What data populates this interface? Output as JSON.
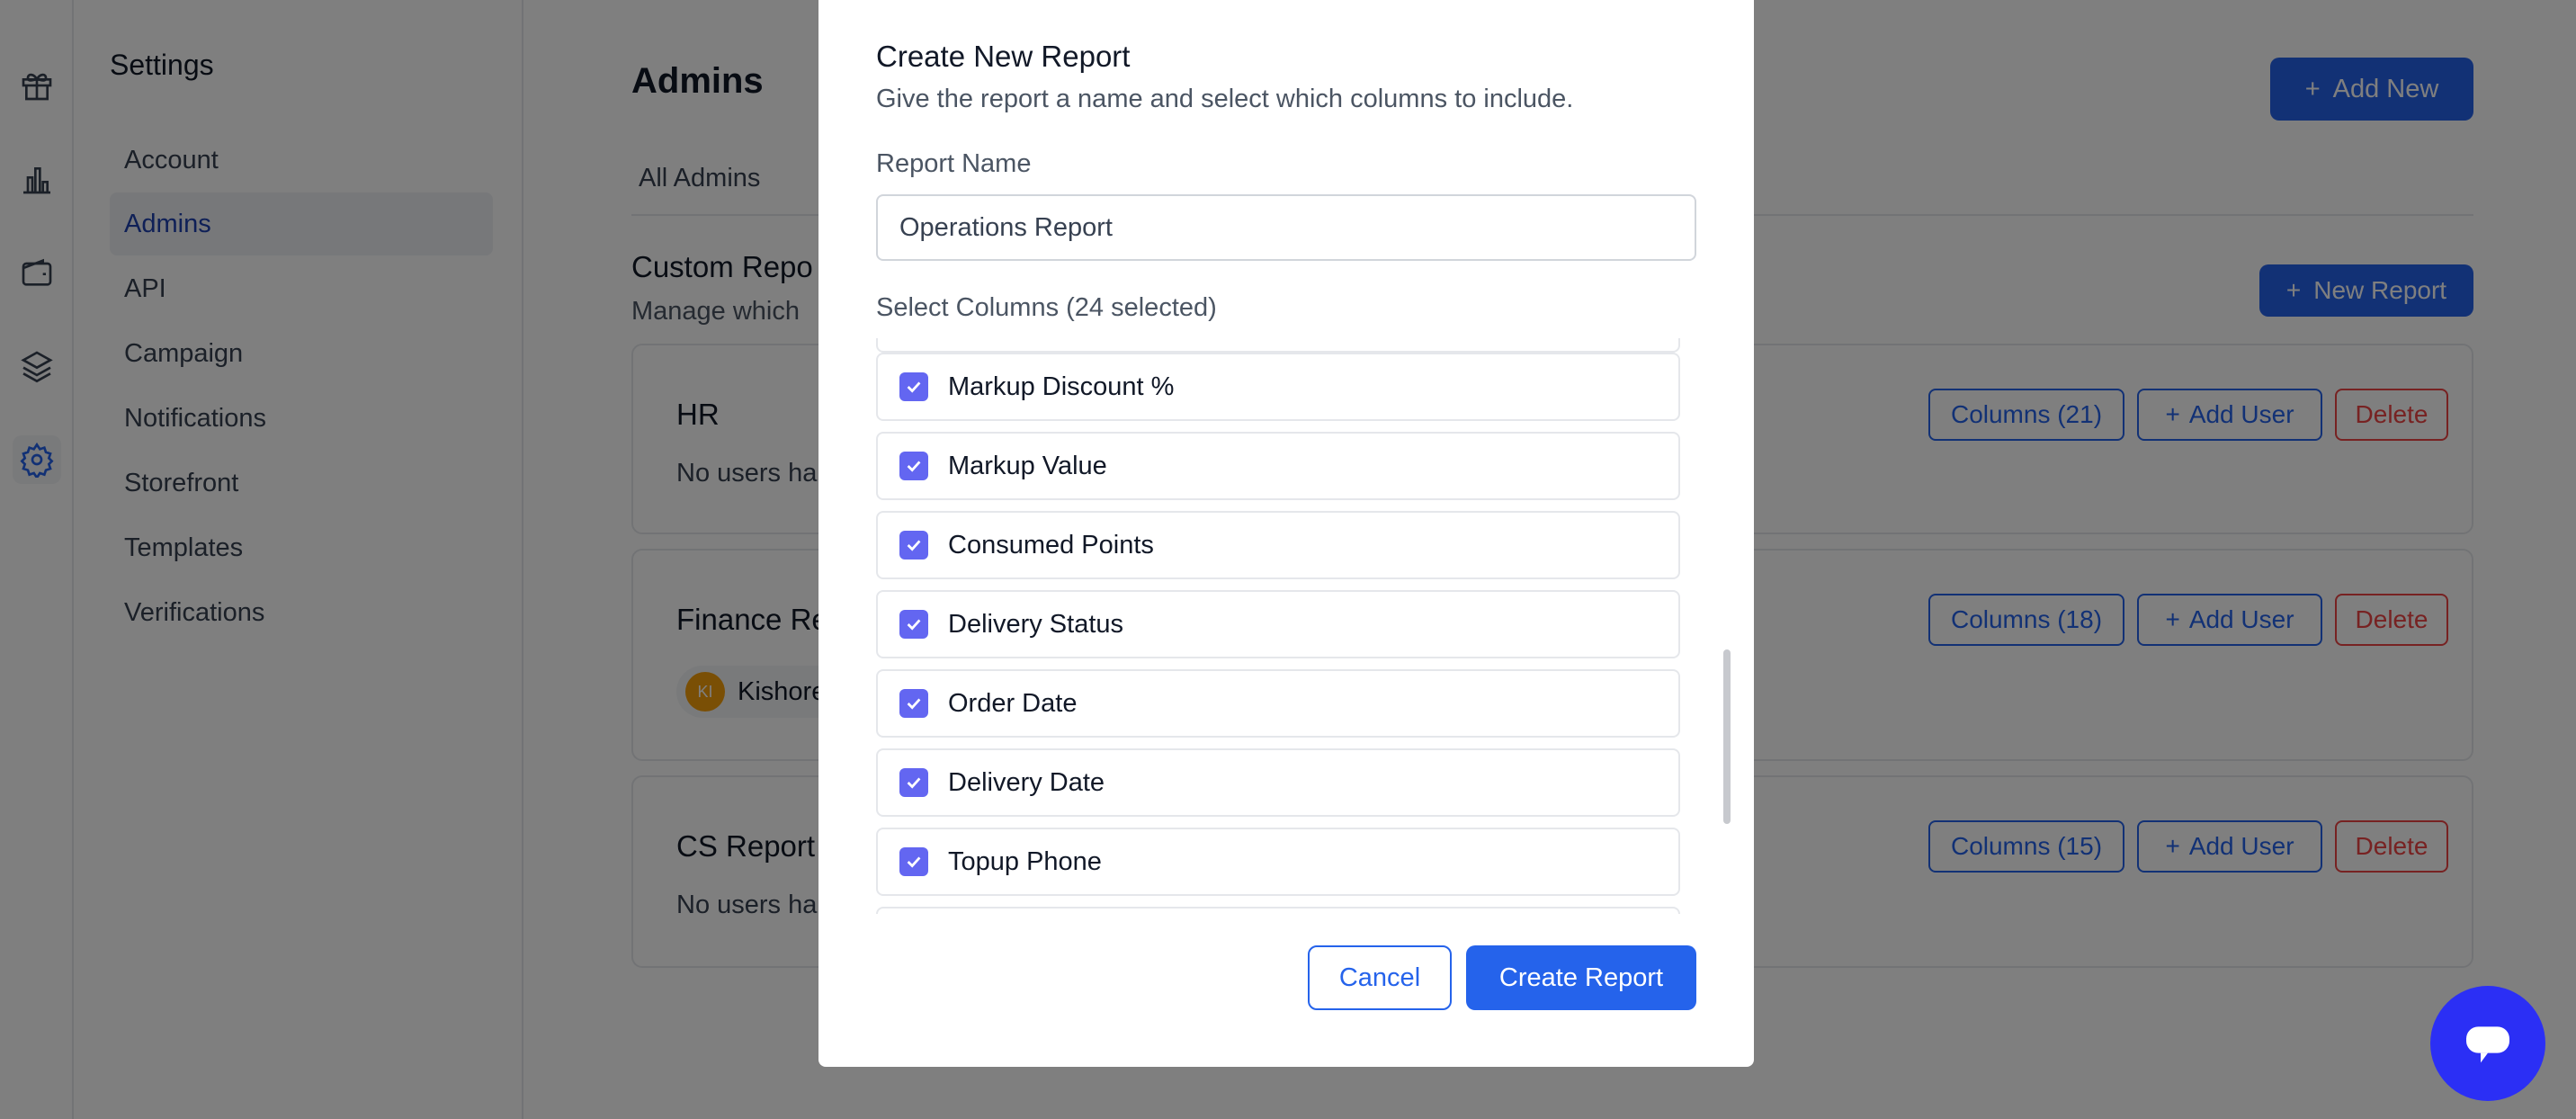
{
  "sidebar": {
    "title": "Settings",
    "items": [
      {
        "label": "Account"
      },
      {
        "label": "Admins"
      },
      {
        "label": "API"
      },
      {
        "label": "Campaign"
      },
      {
        "label": "Notifications"
      },
      {
        "label": "Storefront"
      },
      {
        "label": "Templates"
      },
      {
        "label": "Verifications"
      }
    ]
  },
  "rail_icons": [
    "gift-icon",
    "bar-chart-icon",
    "wallet-icon",
    "layers-icon",
    "gear-icon"
  ],
  "header": {
    "title": "Admins",
    "add_new_label": "Add New"
  },
  "tabs": [
    {
      "label": "All Admins"
    }
  ],
  "custom_reports": {
    "title": "Custom Repo",
    "subtitle": "Manage which",
    "new_report_label": "New Report",
    "cards": [
      {
        "title": "HR",
        "text": "No users ha",
        "columns_label": "Columns (21)",
        "add_user_label": "Add User",
        "delete_label": "Delete"
      },
      {
        "title": "Finance Re",
        "user_initials": "KI",
        "user_name": "Kishore",
        "columns_label": "Columns (18)",
        "add_user_label": "Add User",
        "delete_label": "Delete"
      },
      {
        "title": "CS Report",
        "text": "No users ha",
        "columns_label": "Columns (15)",
        "add_user_label": "Add User",
        "delete_label": "Delete"
      }
    ]
  },
  "modal": {
    "title": "Create New Report",
    "subtitle": "Give the report a name and select which columns to include.",
    "report_name_label": "Report Name",
    "report_name_value": "Operations Report",
    "columns_label": "Select Columns (24 selected)",
    "columns": [
      {
        "label": "Markup Discount %",
        "checked": true
      },
      {
        "label": "Markup Value",
        "checked": true
      },
      {
        "label": "Consumed Points",
        "checked": true
      },
      {
        "label": "Delivery Status",
        "checked": true
      },
      {
        "label": "Order Date",
        "checked": true
      },
      {
        "label": "Delivery Date",
        "checked": true
      },
      {
        "label": "Topup Phone",
        "checked": true
      }
    ],
    "cancel_label": "Cancel",
    "create_label": "Create Report"
  },
  "colors": {
    "primary": "#2563eb",
    "checkbox": "#6366f1",
    "danger": "#ef4444",
    "chat": "#2b2ff5"
  }
}
